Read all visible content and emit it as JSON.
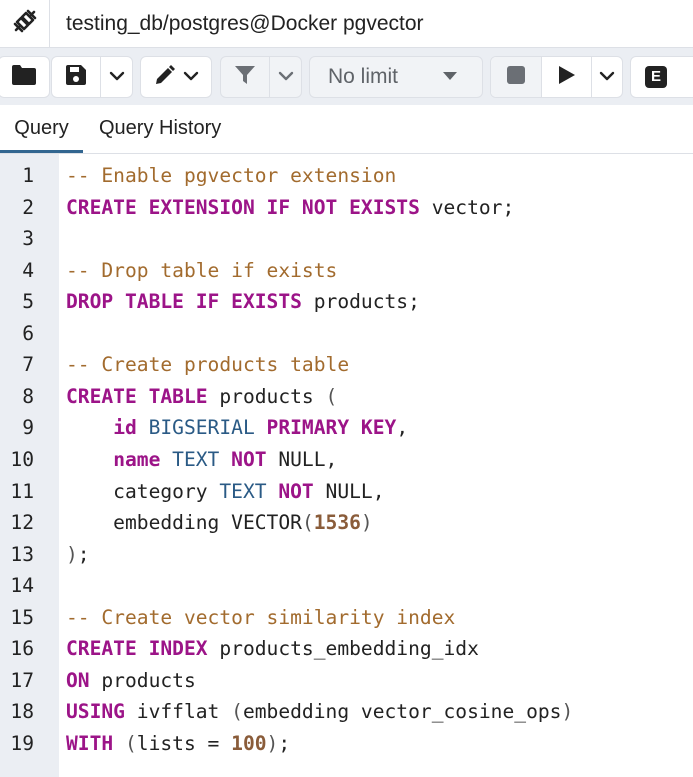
{
  "window": {
    "connection_title": "testing_db/postgres@Docker pgvector",
    "connection_icon": "plug-connected-icon"
  },
  "toolbar": {
    "open_file_icon": "folder-icon",
    "save_icon": "floppy-disk-icon",
    "save_menu_icon": "chevron-down-icon",
    "edit_icon": "pencil-icon",
    "edit_menu_icon": "chevron-down-icon",
    "filter_icon": "funnel-icon",
    "filter_menu_icon": "chevron-down-icon",
    "row_limit": "No limit",
    "stop_icon": "stop-icon",
    "execute_icon": "play-icon",
    "execute_menu_icon": "chevron-down-icon",
    "explain_label": "E"
  },
  "tabs": [
    {
      "label": "Query",
      "active": true
    },
    {
      "label": "Query History",
      "active": false
    }
  ],
  "colors": {
    "comment": "#a26b2e",
    "keyword": "#9c1488",
    "type": "#2a5a85",
    "number": "#8a5c3a",
    "active_tab_underline": "#326690",
    "gutter_bg": "#ebeef3"
  },
  "editor": {
    "lines": [
      {
        "num": "1",
        "tokens": [
          {
            "t": "comment",
            "v": "-- Enable pgvector extension"
          }
        ]
      },
      {
        "num": "2",
        "tokens": [
          {
            "t": "keyword",
            "v": "CREATE EXTENSION IF NOT EXISTS"
          },
          {
            "t": "plain",
            "v": " vector;"
          }
        ]
      },
      {
        "num": "3",
        "tokens": []
      },
      {
        "num": "4",
        "tokens": [
          {
            "t": "comment",
            "v": "-- Drop table if exists"
          }
        ]
      },
      {
        "num": "5",
        "tokens": [
          {
            "t": "keyword",
            "v": "DROP TABLE IF EXISTS"
          },
          {
            "t": "plain",
            "v": " products;"
          }
        ]
      },
      {
        "num": "6",
        "tokens": []
      },
      {
        "num": "7",
        "tokens": [
          {
            "t": "comment",
            "v": "-- Create products table"
          }
        ]
      },
      {
        "num": "8",
        "tokens": [
          {
            "t": "keyword",
            "v": "CREATE TABLE"
          },
          {
            "t": "plain",
            "v": " products "
          },
          {
            "t": "punct",
            "v": "("
          }
        ]
      },
      {
        "num": "9",
        "tokens": [
          {
            "t": "plain",
            "v": "    "
          },
          {
            "t": "keyword",
            "v": "id"
          },
          {
            "t": "plain",
            "v": " "
          },
          {
            "t": "type",
            "v": "BIGSERIAL"
          },
          {
            "t": "plain",
            "v": " "
          },
          {
            "t": "keyword",
            "v": "PRIMARY KEY"
          },
          {
            "t": "plain",
            "v": ","
          }
        ]
      },
      {
        "num": "10",
        "tokens": [
          {
            "t": "plain",
            "v": "    "
          },
          {
            "t": "keyword",
            "v": "name"
          },
          {
            "t": "plain",
            "v": " "
          },
          {
            "t": "type",
            "v": "TEXT"
          },
          {
            "t": "plain",
            "v": " "
          },
          {
            "t": "keyword",
            "v": "NOT"
          },
          {
            "t": "plain",
            "v": " NULL,"
          }
        ]
      },
      {
        "num": "11",
        "tokens": [
          {
            "t": "plain",
            "v": "    category "
          },
          {
            "t": "type",
            "v": "TEXT"
          },
          {
            "t": "plain",
            "v": " "
          },
          {
            "t": "keyword",
            "v": "NOT"
          },
          {
            "t": "plain",
            "v": " NULL,"
          }
        ]
      },
      {
        "num": "12",
        "tokens": [
          {
            "t": "plain",
            "v": "    embedding VECTOR"
          },
          {
            "t": "punct",
            "v": "("
          },
          {
            "t": "number",
            "v": "1536"
          },
          {
            "t": "punct",
            "v": ")"
          }
        ]
      },
      {
        "num": "13",
        "tokens": [
          {
            "t": "punct",
            "v": ")"
          },
          {
            "t": "plain",
            "v": ";"
          }
        ]
      },
      {
        "num": "14",
        "tokens": []
      },
      {
        "num": "15",
        "tokens": [
          {
            "t": "comment",
            "v": "-- Create vector similarity index"
          }
        ]
      },
      {
        "num": "16",
        "tokens": [
          {
            "t": "keyword",
            "v": "CREATE INDEX"
          },
          {
            "t": "plain",
            "v": " products_embedding_idx"
          }
        ]
      },
      {
        "num": "17",
        "tokens": [
          {
            "t": "keyword",
            "v": "ON"
          },
          {
            "t": "plain",
            "v": " products"
          }
        ]
      },
      {
        "num": "18",
        "tokens": [
          {
            "t": "keyword",
            "v": "USING"
          },
          {
            "t": "plain",
            "v": " ivfflat "
          },
          {
            "t": "punct",
            "v": "("
          },
          {
            "t": "plain",
            "v": "embedding vector_cosine_ops"
          },
          {
            "t": "punct",
            "v": ")"
          }
        ]
      },
      {
        "num": "19",
        "tokens": [
          {
            "t": "keyword",
            "v": "WITH"
          },
          {
            "t": "plain",
            "v": " "
          },
          {
            "t": "punct",
            "v": "("
          },
          {
            "t": "plain",
            "v": "lists = "
          },
          {
            "t": "number",
            "v": "100"
          },
          {
            "t": "punct",
            "v": ")"
          },
          {
            "t": "plain",
            "v": ";"
          }
        ]
      }
    ]
  }
}
